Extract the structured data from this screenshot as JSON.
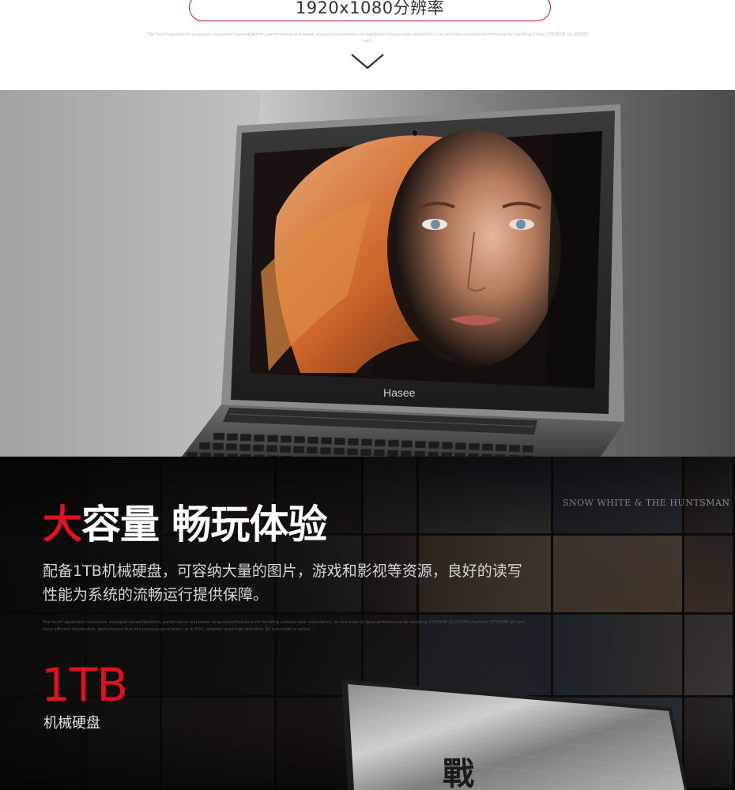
{
  "top": {
    "resolution_label": "1920x1080分辨率",
    "fine_print": "The fourth generation processor, equipped haswellplatform, performance and power all good performance for handling complex task redundancy, so new base all good performance for handling. Using GTX950M 2G GDDR5 ram"
  },
  "laptop": {
    "brand_logo": "Hasee"
  },
  "storage": {
    "headline_highlight": "大",
    "headline_rest": "容量 畅玩体验",
    "description": "配备1TB机械硬盘，可容纳大量的图片，游戏和影视等资源，良好的读写性能为系统的流畅运行提供保障。",
    "fine_print": "The fourth generation processor, equipped haswellplatform, performance and power all good performance for handling complex task redundancy, so new base all good performance for handling GTX950M 2G GDDR5 memory. GTX950M 2G ram more efficient introduction, performance than the previous generation up to 30%, whether large high-definition 3D role-mode or action...",
    "capacity_value": "1TB",
    "capacity_label": "机械硬盘",
    "poster_text": "SNOW WHITE & THE HUNTSMAN"
  },
  "colors": {
    "accent_red": "#e0101e",
    "pill_border": "#c8102e"
  }
}
